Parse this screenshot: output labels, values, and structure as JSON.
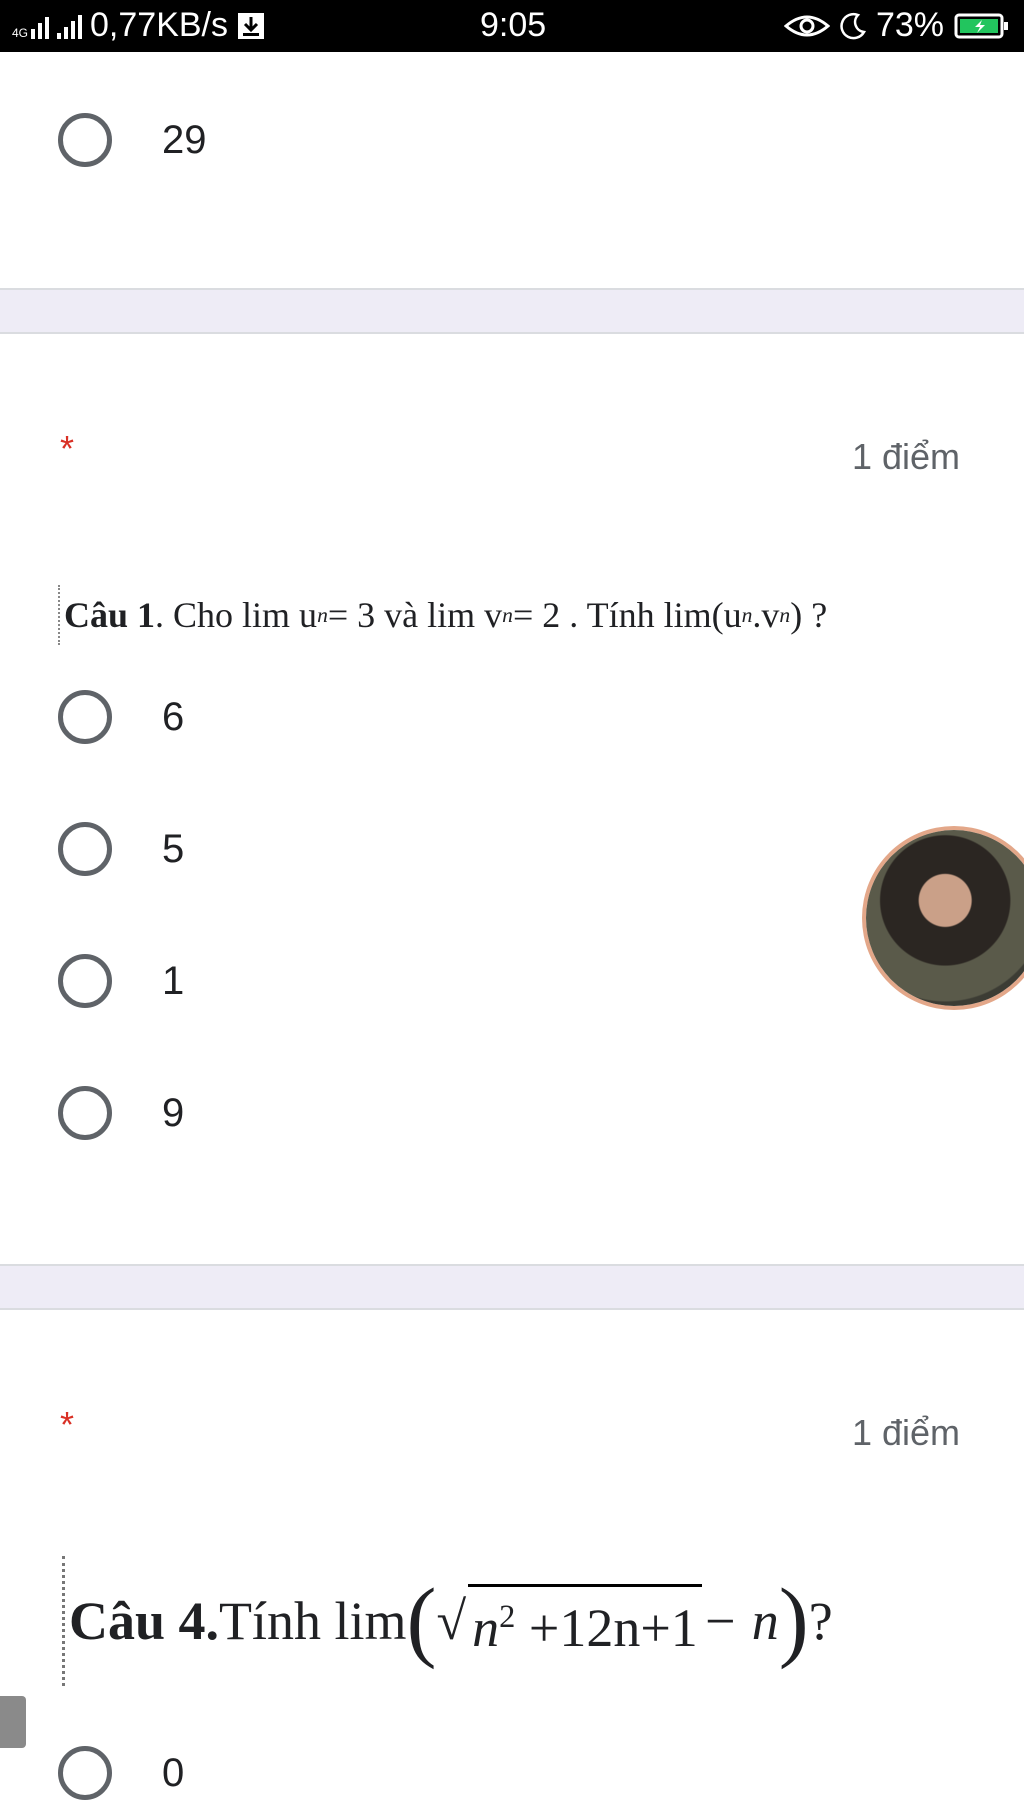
{
  "status_bar": {
    "network_type": "4G",
    "speed": "0,77KB/s",
    "time": "9:05",
    "battery": "73%"
  },
  "previous_question": {
    "options": [
      "29"
    ]
  },
  "question1": {
    "required_marker": "*",
    "points": "1 điểm",
    "prompt_bold": "Câu 1",
    "prompt_text": ". Cho lim u",
    "prompt_rest": " = 3  và lim v",
    "prompt_rest2": " = 2 . Tính lim",
    "prompt_paren": "(u",
    "prompt_mid": ".v",
    "prompt_end": ") ?",
    "sub_n": "n",
    "options": [
      "6",
      "5",
      "1",
      "9"
    ]
  },
  "question4": {
    "required_marker": "*",
    "points": "1 điểm",
    "prompt_bold": "Câu 4.",
    "prompt_text": " Tính lim",
    "prompt_sqrt": "n",
    "prompt_sqrt_exp": "2",
    "prompt_sqrt_rest": " +12n+1",
    "prompt_after": " − n",
    "prompt_close": ")",
    "prompt_qmark": "?",
    "options": [
      "0"
    ]
  },
  "colors": {
    "required": "#d93025",
    "separator": "#eeecf6",
    "radio_border": "#5f6368"
  }
}
